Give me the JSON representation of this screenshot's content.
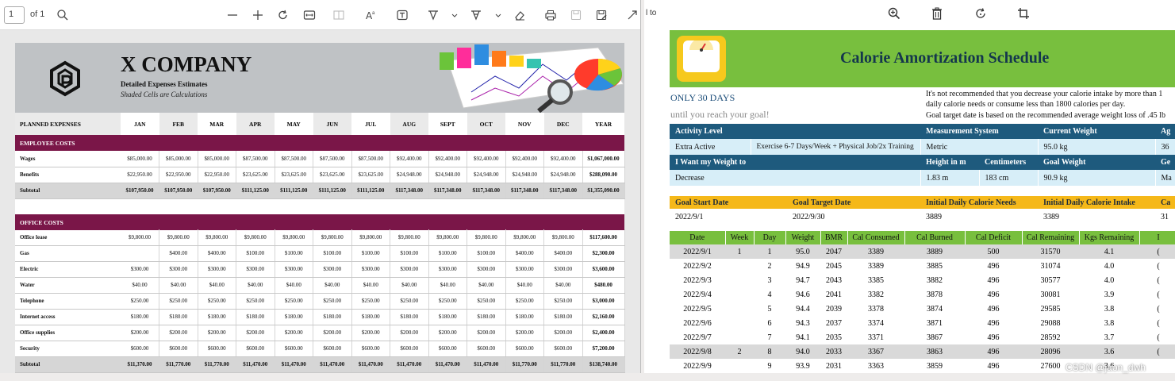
{
  "viewer": {
    "page_number": "1",
    "of_label": "of 1"
  },
  "left_doc": {
    "company": "X COMPANY",
    "subtitle": "Detailed Expenses Estimates",
    "note": "Shaded Cells are Calculations",
    "header_label": "PLANNED EXPENSES",
    "months": [
      "JAN",
      "FEB",
      "MAR",
      "APR",
      "MAY",
      "JUN",
      "JUL",
      "AUG",
      "SEPT",
      "OCT",
      "NOV",
      "DEC",
      "YEAR"
    ],
    "employee_costs": {
      "title": "EMPLOYEE COSTS",
      "rows": [
        {
          "label": "Wages",
          "values": [
            "$85,000.00",
            "$85,000.00",
            "$85,000.00",
            "$87,500.00",
            "$87,500.00",
            "$87,500.00",
            "$87,500.00",
            "$92,400.00",
            "$92,400.00",
            "$92,400.00",
            "$92,400.00",
            "$92,400.00",
            "$1,067,000.00"
          ]
        },
        {
          "label": "Benefits",
          "values": [
            "$22,950.00",
            "$22,950.00",
            "$22,950.00",
            "$23,625.00",
            "$23,625.00",
            "$23,625.00",
            "$23,625.00",
            "$24,948.00",
            "$24,948.00",
            "$24,948.00",
            "$24,948.00",
            "$24,948.00",
            "$288,090.00"
          ]
        },
        {
          "label": "Subtotal",
          "values": [
            "$107,950.00",
            "$107,950.00",
            "$107,950.00",
            "$111,125.00",
            "$111,125.00",
            "$111,125.00",
            "$111,125.00",
            "$117,348.00",
            "$117,348.00",
            "$117,348.00",
            "$117,348.00",
            "$117,348.00",
            "$1,355,090.00"
          ]
        }
      ]
    },
    "office_costs": {
      "title": "OFFICE COSTS",
      "rows": [
        {
          "label": "Office lease",
          "values": [
            "$9,800.00",
            "$9,800.00",
            "$9,800.00",
            "$9,800.00",
            "$9,800.00",
            "$9,800.00",
            "$9,800.00",
            "$9,800.00",
            "$9,800.00",
            "$9,800.00",
            "$9,800.00",
            "$9,800.00",
            "$117,600.00"
          ]
        },
        {
          "label": "Gas",
          "values": [
            "",
            "$400.00",
            "$400.00",
            "$100.00",
            "$100.00",
            "$100.00",
            "$100.00",
            "$100.00",
            "$100.00",
            "$100.00",
            "$400.00",
            "$400.00",
            "$2,300.00"
          ]
        },
        {
          "label": "Electric",
          "values": [
            "$300.00",
            "$300.00",
            "$300.00",
            "$300.00",
            "$300.00",
            "$300.00",
            "$300.00",
            "$300.00",
            "$300.00",
            "$300.00",
            "$300.00",
            "$300.00",
            "$3,600.00"
          ]
        },
        {
          "label": "Water",
          "values": [
            "$40.00",
            "$40.00",
            "$40.00",
            "$40.00",
            "$40.00",
            "$40.00",
            "$40.00",
            "$40.00",
            "$40.00",
            "$40.00",
            "$40.00",
            "$40.00",
            "$480.00"
          ]
        },
        {
          "label": "Telephone",
          "values": [
            "$250.00",
            "$250.00",
            "$250.00",
            "$250.00",
            "$250.00",
            "$250.00",
            "$250.00",
            "$250.00",
            "$250.00",
            "$250.00",
            "$250.00",
            "$250.00",
            "$3,000.00"
          ]
        },
        {
          "label": "Internet access",
          "values": [
            "$180.00",
            "$180.00",
            "$180.00",
            "$180.00",
            "$180.00",
            "$180.00",
            "$180.00",
            "$180.00",
            "$180.00",
            "$180.00",
            "$180.00",
            "$180.00",
            "$2,160.00"
          ]
        },
        {
          "label": "Office supplies",
          "values": [
            "$200.00",
            "$200.00",
            "$200.00",
            "$200.00",
            "$200.00",
            "$200.00",
            "$200.00",
            "$200.00",
            "$200.00",
            "$200.00",
            "$200.00",
            "$200.00",
            "$2,400.00"
          ]
        },
        {
          "label": "Security",
          "values": [
            "$600.00",
            "$600.00",
            "$600.00",
            "$600.00",
            "$600.00",
            "$600.00",
            "$600.00",
            "$600.00",
            "$600.00",
            "$600.00",
            "$600.00",
            "$600.00",
            "$7,200.00"
          ]
        },
        {
          "label": "Subtotal",
          "values": [
            "$11,370.00",
            "$11,770.00",
            "$11,770.00",
            "$11,470.00",
            "$11,470.00",
            "$11,470.00",
            "$11,470.00",
            "$11,470.00",
            "$11,470.00",
            "$11,470.00",
            "$11,770.00",
            "$11,770.00",
            "$138,740.00"
          ]
        }
      ]
    }
  },
  "right_partial_text": "l to",
  "right_doc": {
    "title": "Calorie Amortization Schedule",
    "only": "ONLY 30 DAYS",
    "until": "until you reach your goal!",
    "note_line1": "It's not recommended that you decrease your calorie intake by more than 1",
    "note_line2": "daily calorie needs or consume less than 1800 calories per day.",
    "note_line3": "Goal target date is based on the recommended average weight loss of .45 lb",
    "row1_headers": [
      "Activity Level",
      "",
      "Measurement System",
      "Current Weight",
      "Ag"
    ],
    "row1_values": [
      "Extra Active",
      "Exercise 6-7 Days/Week + Physical Job/2x Training",
      "Metric",
      "95.0 kg",
      "36"
    ],
    "row2_headers": [
      "I Want my Weight to",
      "",
      "Height in m",
      "Centimeters",
      "Goal Weight",
      "Ge"
    ],
    "row2_values": [
      "Decrease",
      "",
      "1.83 m",
      "183 cm",
      "90.9 kg",
      "Ma"
    ],
    "goal_headers": [
      "Goal Start Date",
      "Goal Target Date",
      "Initial Daily Calorie Needs",
      "Initial Daily Calorie Intake",
      "Ca"
    ],
    "goal_values": [
      "2022/9/1",
      "2022/9/30",
      "3889",
      "3389",
      "31"
    ],
    "sched_headers": [
      "Date",
      "Week",
      "Day",
      "Weight",
      "BMR",
      "Cal Consumed",
      "Cal Burned",
      "Cal Deficit",
      "Cal Remaining",
      "Kgs Remaining",
      "I"
    ],
    "sched_rows": [
      [
        "2022/9/1",
        "1",
        "1",
        "95.0",
        "2047",
        "3389",
        "3889",
        "500",
        "31570",
        "4.1",
        "("
      ],
      [
        "2022/9/2",
        "",
        "2",
        "94.9",
        "2045",
        "3389",
        "3885",
        "496",
        "31074",
        "4.0",
        "("
      ],
      [
        "2022/9/3",
        "",
        "3",
        "94.7",
        "2043",
        "3385",
        "3882",
        "496",
        "30577",
        "4.0",
        "("
      ],
      [
        "2022/9/4",
        "",
        "4",
        "94.6",
        "2041",
        "3382",
        "3878",
        "496",
        "30081",
        "3.9",
        "("
      ],
      [
        "2022/9/5",
        "",
        "5",
        "94.4",
        "2039",
        "3378",
        "3874",
        "496",
        "29585",
        "3.8",
        "("
      ],
      [
        "2022/9/6",
        "",
        "6",
        "94.3",
        "2037",
        "3374",
        "3871",
        "496",
        "29088",
        "3.8",
        "("
      ],
      [
        "2022/9/7",
        "",
        "7",
        "94.1",
        "2035",
        "3371",
        "3867",
        "496",
        "28592",
        "3.7",
        "("
      ],
      [
        "2022/9/8",
        "2",
        "8",
        "94.0",
        "2033",
        "3367",
        "3863",
        "496",
        "28096",
        "3.6",
        "("
      ],
      [
        "2022/9/9",
        "",
        "9",
        "93.9",
        "2031",
        "3363",
        "3859",
        "496",
        "27600",
        "3.6",
        ""
      ]
    ]
  },
  "watermark": "CSDN @jaon_dwh"
}
